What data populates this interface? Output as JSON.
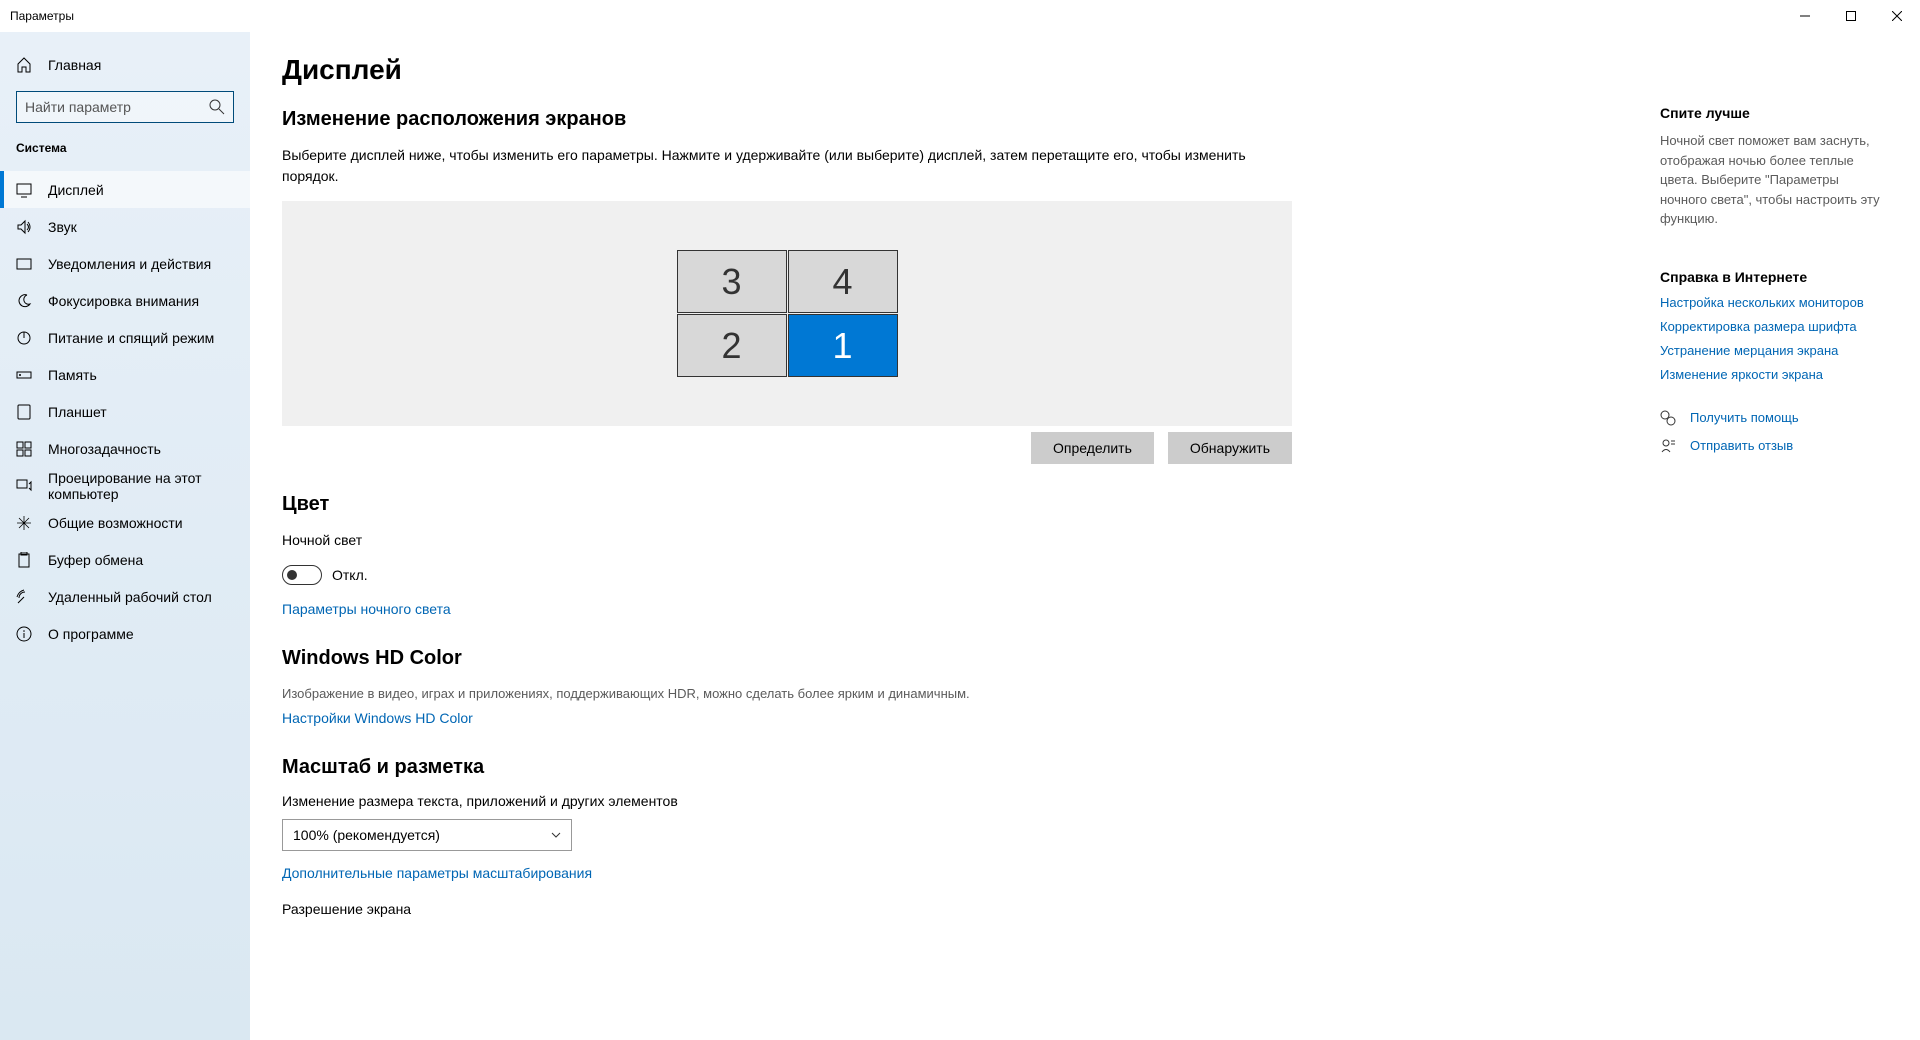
{
  "window": {
    "title": "Параметры"
  },
  "sidebar": {
    "home": "Главная",
    "search_placeholder": "Найти параметр",
    "section": "Система",
    "items": [
      {
        "label": "Дисплей"
      },
      {
        "label": "Звук"
      },
      {
        "label": "Уведомления и действия"
      },
      {
        "label": "Фокусировка внимания"
      },
      {
        "label": "Питание и спящий режим"
      },
      {
        "label": "Память"
      },
      {
        "label": "Планшет"
      },
      {
        "label": "Многозадачность"
      },
      {
        "label": "Проецирование на этот компьютер"
      },
      {
        "label": "Общие возможности"
      },
      {
        "label": "Буфер обмена"
      },
      {
        "label": "Удаленный рабочий стол"
      },
      {
        "label": "О программе"
      }
    ]
  },
  "main": {
    "title": "Дисплей",
    "arrange_heading": "Изменение расположения экранов",
    "arrange_desc": "Выберите дисплей ниже, чтобы изменить его параметры. Нажмите и удерживайте (или выберите) дисплей, затем перетащите его, чтобы изменить порядок.",
    "monitors": [
      "3",
      "4",
      "2",
      "1"
    ],
    "identify_btn": "Определить",
    "detect_btn": "Обнаружить",
    "color_heading": "Цвет",
    "night_light_label": "Ночной свет",
    "toggle_off": "Откл.",
    "night_light_settings": "Параметры ночного света",
    "hdr_heading": "Windows HD Color",
    "hdr_desc": "Изображение в видео, играх и приложениях, поддерживающих HDR, можно сделать более ярким и динамичным.",
    "hdr_link": "Настройки Windows HD Color",
    "scale_heading": "Масштаб и разметка",
    "scale_label": "Изменение размера текста, приложений и других элементов",
    "scale_value": "100% (рекомендуется)",
    "scale_adv_link": "Дополнительные параметры масштабирования",
    "resolution_label": "Разрешение экрана"
  },
  "right": {
    "sleep_heading": "Спите лучше",
    "sleep_text": "Ночной свет поможет вам заснуть, отображая ночью более теплые цвета. Выберите \"Параметры ночного света\", чтобы настроить эту функцию.",
    "help_heading": "Справка в Интернете",
    "links": [
      "Настройка нескольких мониторов",
      "Корректировка размера шрифта",
      "Устранение мерцания экрана",
      "Изменение яркости экрана"
    ],
    "get_help": "Получить помощь",
    "feedback": "Отправить отзыв"
  }
}
